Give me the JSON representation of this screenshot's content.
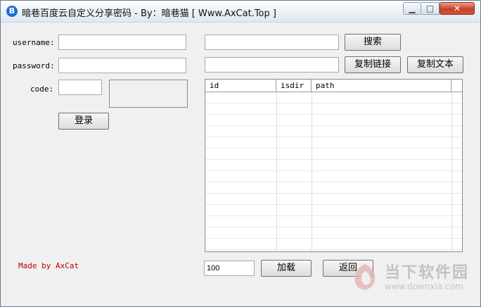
{
  "window": {
    "title": "暗巷百度云自定义分享密码 - By：暗巷猫 [ Www.AxCat.Top ]",
    "app_icon": "B",
    "minimize": "▁",
    "maximize": "□",
    "close": "✕"
  },
  "login": {
    "username_label": "username:",
    "username_value": "",
    "password_label": "password:",
    "password_value": "",
    "code_label": "code:",
    "code_value": "",
    "login_button": "登录"
  },
  "search": {
    "search_value": "",
    "search_button": "搜索",
    "link_value": "",
    "copy_link_button": "复制链接",
    "copy_text_button": "复制文本"
  },
  "table": {
    "columns": [
      "id",
      "isdir",
      "path"
    ],
    "rows": []
  },
  "pager": {
    "count_value": "100",
    "load_button": "加载",
    "back_button": "返回"
  },
  "footer": {
    "made_by": "Made by AxCat"
  },
  "watermark": {
    "name": "当下软件园",
    "url": "www.downxia.com"
  }
}
